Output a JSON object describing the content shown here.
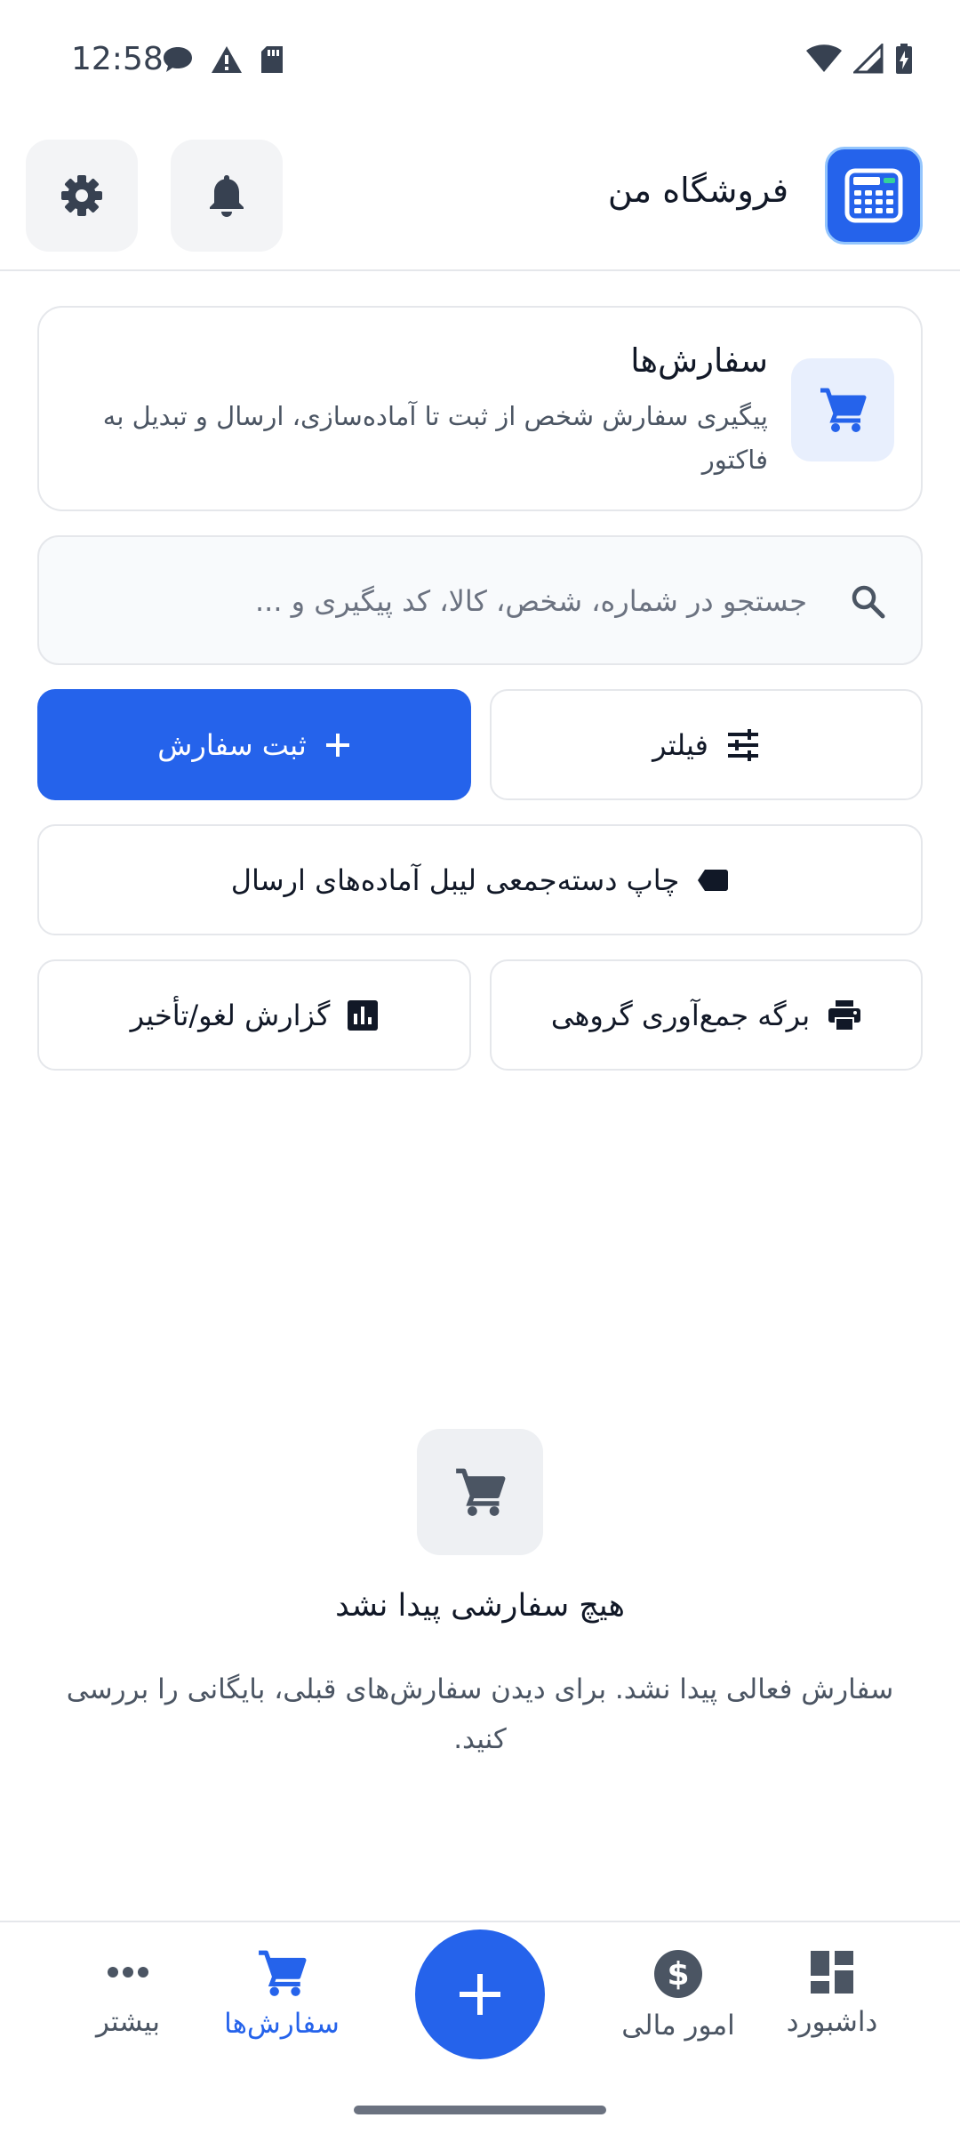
{
  "status_bar": {
    "time": "12:58",
    "left_icons": [
      "chat-bubble-icon",
      "warning-icon",
      "sd-card-icon"
    ],
    "right_icons": [
      "wifi-icon",
      "signal-icon",
      "battery-charging-icon"
    ]
  },
  "header": {
    "title": "فروشگاه من",
    "logo_icon": "cash-register-icon",
    "notification_icon": "bell-icon",
    "settings_icon": "gear-icon"
  },
  "orders_card": {
    "title": "سفارش‌ها",
    "description": "پیگیری سفارش شخص از ثبت تا آماده‌سازی، ارسال و تبدیل به فاکتور",
    "icon": "cart-icon"
  },
  "search": {
    "placeholder": "جستجو در شماره، شخص، کالا، کد پیگیری و ...",
    "value": ""
  },
  "actions": {
    "filter_label": "فیلتر",
    "new_order_label": "ثبت سفارش",
    "print_labels_label": "چاپ دسته‌جمعی لیبل آماده‌های ارسال",
    "pick_sheet_label": "برگه جمع‌آوری گروهی",
    "cancel_report_label": "گزارش لغو/تأخیر"
  },
  "empty_state": {
    "title": "هیچ سفارشی پیدا نشد",
    "description": "سفارش فعالی پیدا نشد. برای دیدن سفارش‌های قبلی، بایگانی را بررسی کنید."
  },
  "bottom_nav": {
    "items": [
      {
        "label": "داشبورد",
        "icon": "dashboard-icon",
        "active": false
      },
      {
        "label": "امور مالی",
        "icon": "dollar-icon",
        "active": false
      },
      {
        "label": "سفارش‌ها",
        "icon": "cart-icon",
        "active": true
      },
      {
        "label": "بیشتر",
        "icon": "more-icon",
        "active": false
      }
    ],
    "fab_icon": "plus-icon"
  },
  "colors": {
    "primary": "#2563eb",
    "text": "#111827",
    "muted": "#4b5563",
    "border": "#e5e7eb"
  }
}
